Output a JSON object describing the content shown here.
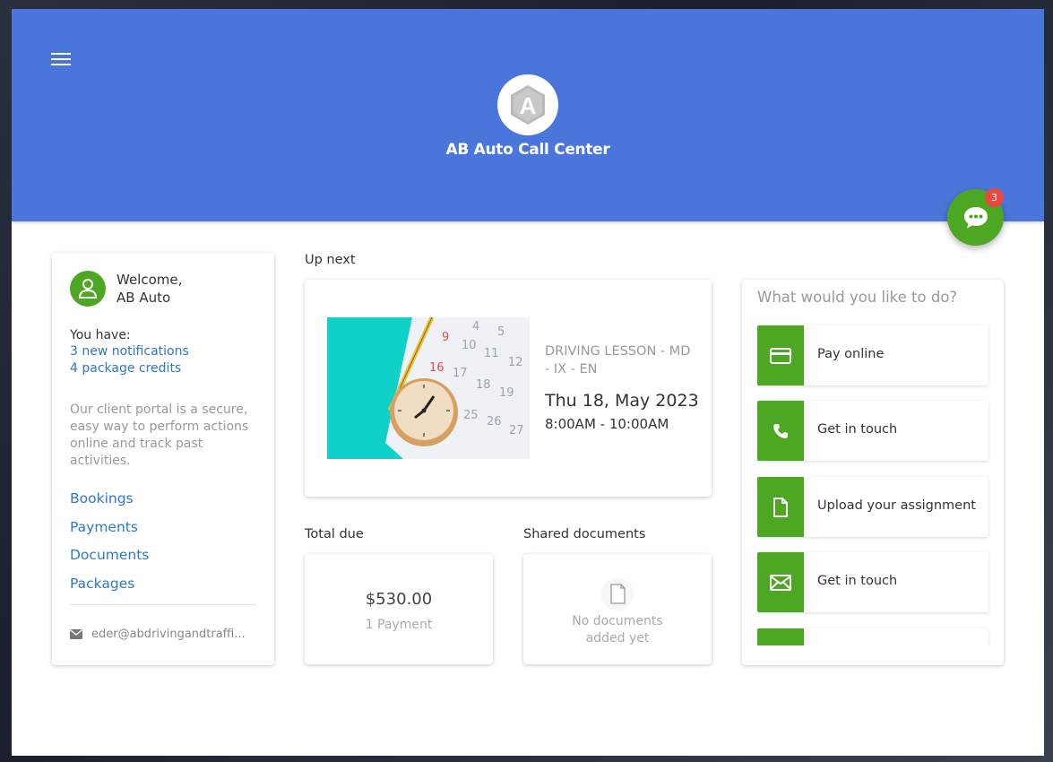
{
  "header": {
    "brand": "AB Auto Call Center",
    "chat_badge_count": "3"
  },
  "user": {
    "welcome": "Welcome,",
    "name": "AB Auto",
    "you_have": "You have:",
    "notifications": "3 new notifications",
    "package_credits": "4 package credits",
    "description": "Our client portal is a secure, easy way to perform actions online and track past activities.",
    "nav": [
      "Bookings",
      "Payments",
      "Documents",
      "Packages"
    ],
    "email": "eder@abdrivingandtraffi..."
  },
  "up_next": {
    "title": "Up next",
    "lesson_name": "DRIVING LESSON - MD - IX - EN",
    "date": "Thu 18, May 2023",
    "time": "8:00AM - 10:00AM"
  },
  "total_due": {
    "title": "Total due",
    "amount": "$530.00",
    "count": "1 Payment"
  },
  "shared_documents": {
    "title": "Shared documents",
    "empty_line1": "No documents",
    "empty_line2": "added yet"
  },
  "actions": {
    "title": "What would you like to do?",
    "items": [
      {
        "label": "Pay online",
        "icon": "credit-card-icon"
      },
      {
        "label": "Get in touch",
        "icon": "phone-icon"
      },
      {
        "label": "Upload your assignment",
        "icon": "file-icon"
      },
      {
        "label": "Get in touch",
        "icon": "envelope-icon"
      },
      {
        "label": "",
        "icon": ""
      }
    ]
  },
  "colors": {
    "header": "#4a76dc",
    "accent_green": "#4ea723",
    "link_blue": "#2d78c8",
    "badge_red": "#e9483f"
  }
}
